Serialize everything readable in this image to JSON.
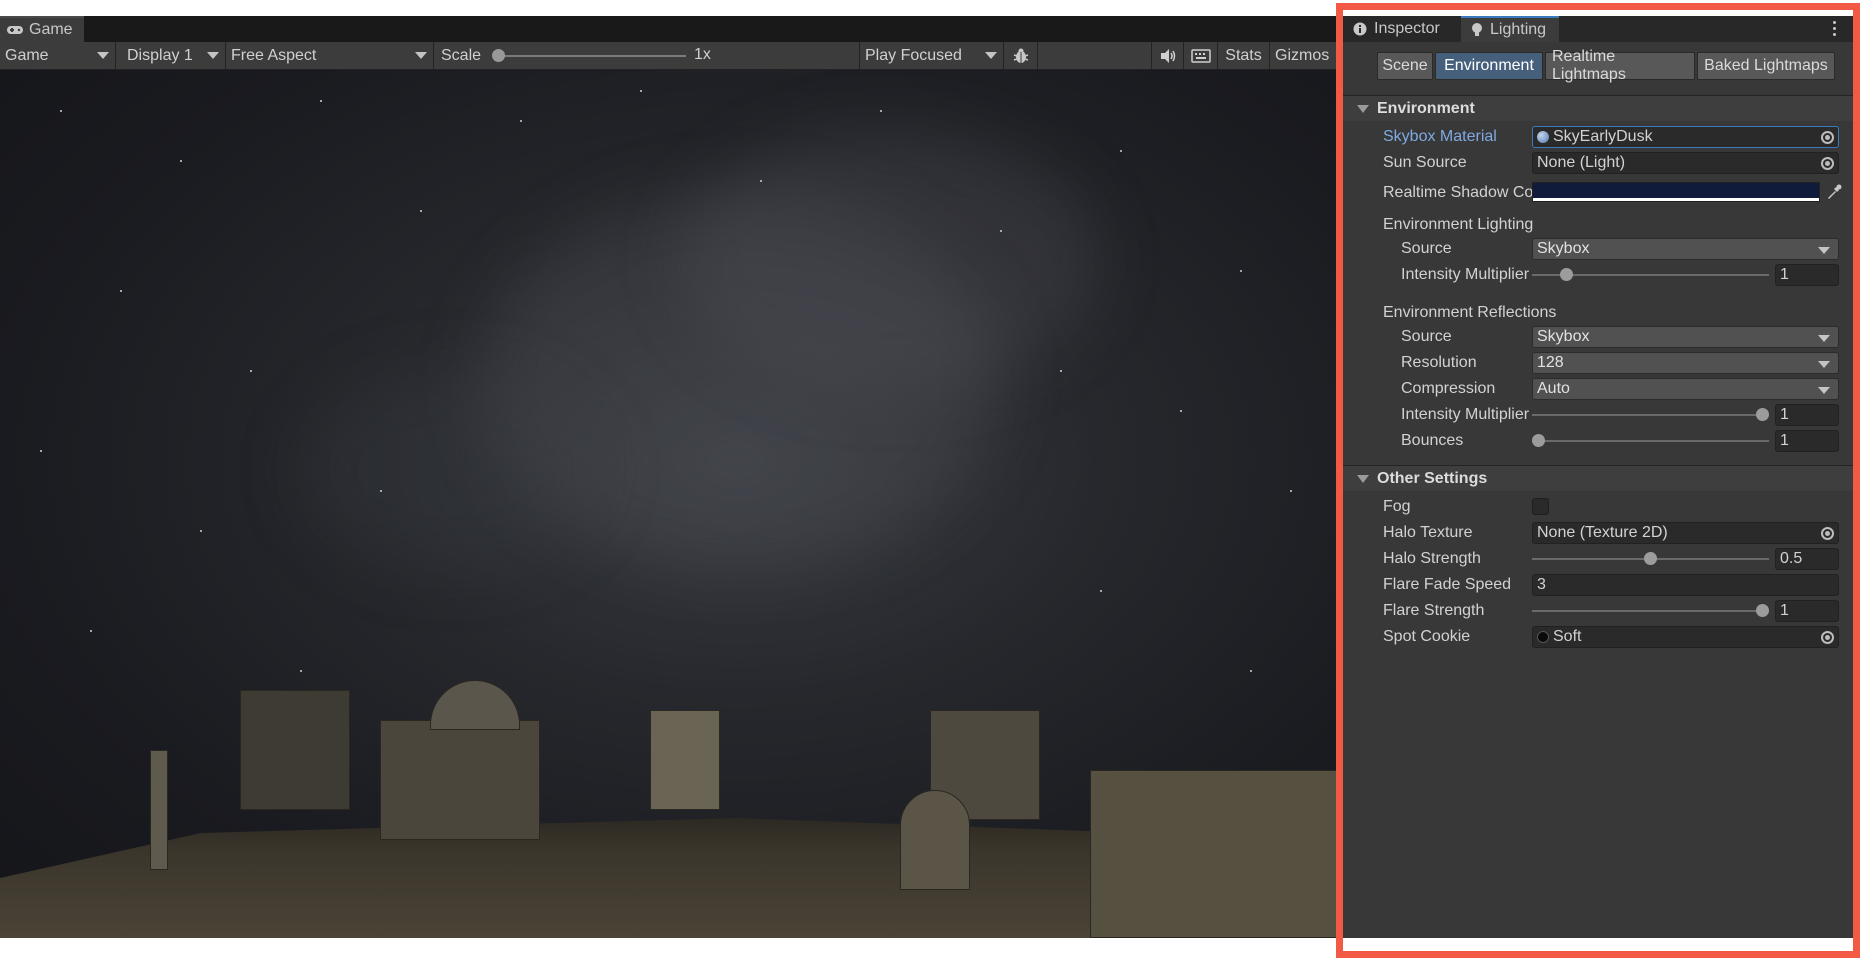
{
  "game": {
    "tab_label": "Game",
    "toolbar": {
      "view_mode": "Game",
      "display": "Display 1",
      "aspect": "Free Aspect",
      "scale_label": "Scale",
      "scale_value": "1x",
      "play_mode": "Play Focused",
      "stats_label": "Stats",
      "gizmos_label": "Gizmos"
    }
  },
  "panel": {
    "tabs": [
      {
        "label": "Inspector"
      },
      {
        "label": "Lighting"
      }
    ],
    "subtabs": [
      {
        "label": "Scene"
      },
      {
        "label": "Environment"
      },
      {
        "label": "Realtime Lightmaps"
      },
      {
        "label": "Baked Lightmaps"
      }
    ],
    "environment": {
      "header": "Environment",
      "skybox_material_label": "Skybox Material",
      "skybox_material_value": "SkyEarlyDusk",
      "sun_source_label": "Sun Source",
      "sun_source_value": "None (Light)",
      "shadow_color_label": "Realtime Shadow Color",
      "shadow_color": "#101a3a",
      "lighting": {
        "header": "Environment Lighting",
        "source_label": "Source",
        "source_value": "Skybox",
        "intensity_label": "Intensity Multiplier",
        "intensity_value": "1",
        "intensity_fraction": 0.125
      },
      "reflections": {
        "header": "Environment Reflections",
        "source_label": "Source",
        "source_value": "Skybox",
        "resolution_label": "Resolution",
        "resolution_value": "128",
        "compression_label": "Compression",
        "compression_value": "Auto",
        "intensity_label": "Intensity Multiplier",
        "intensity_value": "1",
        "intensity_fraction": 1.0,
        "bounces_label": "Bounces",
        "bounces_value": "1",
        "bounces_fraction": 0.0
      }
    },
    "other": {
      "header": "Other Settings",
      "fog_label": "Fog",
      "fog_checked": false,
      "halo_texture_label": "Halo Texture",
      "halo_texture_value": "None (Texture 2D)",
      "halo_strength_label": "Halo Strength",
      "halo_strength_value": "0.5",
      "halo_strength_fraction": 0.5,
      "flare_fade_label": "Flare Fade Speed",
      "flare_fade_value": "3",
      "flare_strength_label": "Flare Strength",
      "flare_strength_value": "1",
      "flare_strength_fraction": 1.0,
      "spot_cookie_label": "Spot Cookie",
      "spot_cookie_value": "Soft"
    }
  },
  "colors": {
    "accent_blue": "#3a79bb",
    "active_subtab": "#46607c",
    "highlight_label": "#7fa9e2",
    "outline": "#f25a45"
  },
  "icons": {
    "game_tab": "gamepad-icon",
    "inspector_tab": "info-icon",
    "lighting_tab": "lightbulb-icon",
    "bug": "bug-icon",
    "audio": "speaker-icon",
    "keyboard": "keyboard-icon",
    "eyedropper": "eyedropper-icon",
    "object_picker": "object-picker-icon"
  }
}
